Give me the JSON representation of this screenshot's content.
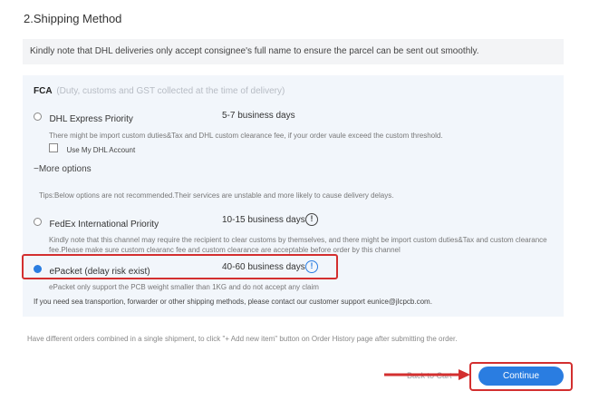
{
  "section": {
    "title": "2.Shipping Method"
  },
  "notice": "Kindly note that DHL deliveries only accept consignee's full name to ensure the parcel can be sent out smoothly.",
  "fca": {
    "label": "FCA",
    "sub": "(Duty, customs and GST collected at the time of delivery)"
  },
  "dhl": {
    "name": "DHL Express Priority",
    "days": "5-7 business days",
    "note": "There might be import custom duties&Tax and DHL custom clearance fee, if your order vaule exceed the custom threshold.",
    "checkbox_label": "Use My DHL Account"
  },
  "more_options": "More options",
  "tips": "Tips:Below options are not recommended.Their services are unstable and more likely to cause delivery delays.",
  "fedex": {
    "name": "FedEx International Priority",
    "days": "10-15 business days",
    "note_line1": "Kindly note that this channel may require the recipient to clear customs by themselves, and there might be import custom duties&Tax and custom clearance",
    "note_line2": "fee.Please make sure custom clearanc fee and custom clearance are acceptable before order by this channel"
  },
  "epacket": {
    "name": "ePacket (delay risk exist)",
    "days": "40-60 business days",
    "note": "ePacket only support the PCB weight smaller than 1KG and do not accept any claim"
  },
  "sea_note": "If you need sea transportion, forwarder or other shipping methods, please contact our customer support eunice@jlcpcb.com.",
  "combine_note": "Have different orders combined in a single shipment, to click \"+ Add new item\" button on Order History page after submitting the order.",
  "actions": {
    "back": "Back to Cart",
    "continue": "Continue"
  },
  "icons": {
    "info": "info-icon",
    "arrow": "red-arrow-icon"
  },
  "colors": {
    "accent": "#2a7de1",
    "highlight": "#d32f2f",
    "panel": "#f2f6fb"
  }
}
